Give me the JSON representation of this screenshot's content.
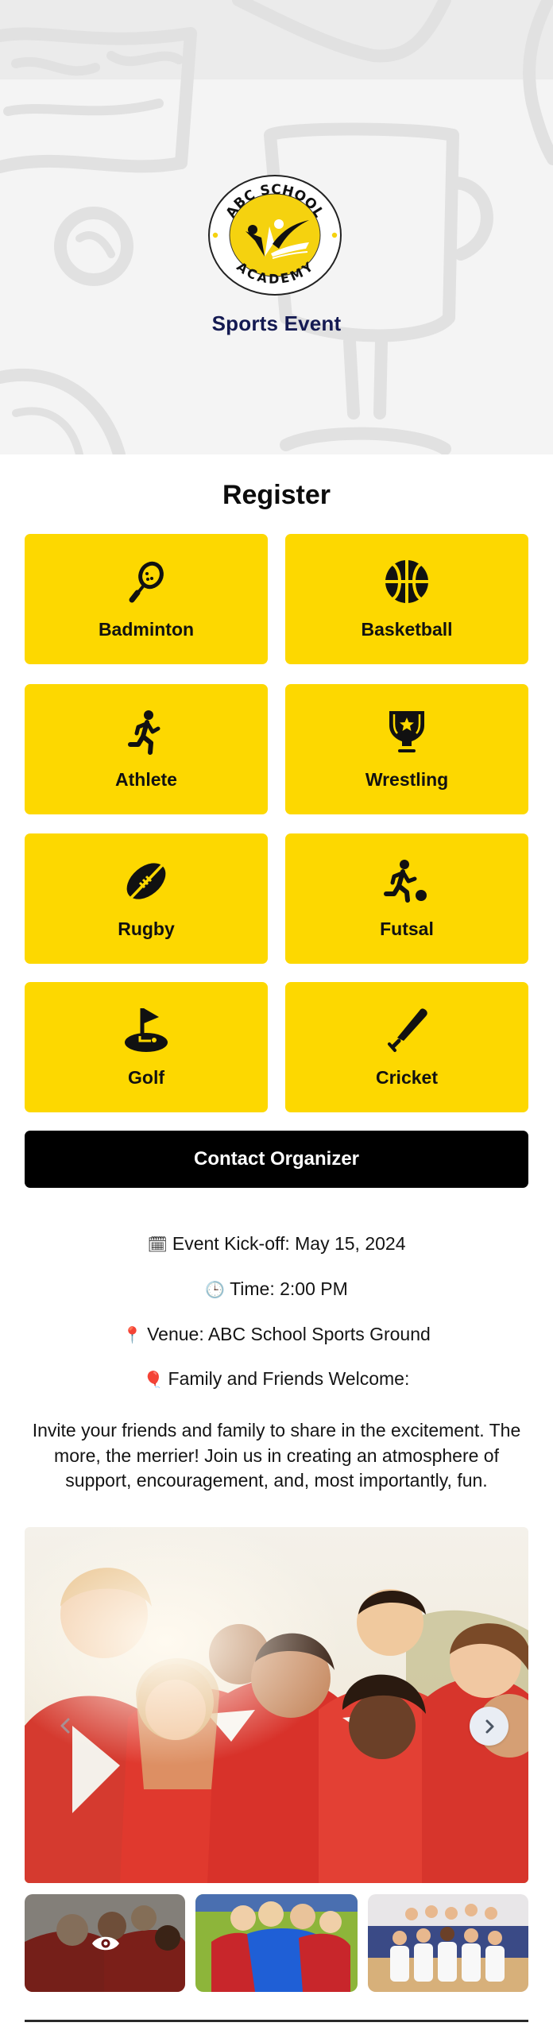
{
  "header": {
    "logo": {
      "top_text": "ABC SCHOOL",
      "bottom_text": "ACADEMY",
      "icon": "school-academy-logo"
    },
    "event_title": "Sports Event"
  },
  "register": {
    "title": "Register",
    "tiles": [
      {
        "label": "Badminton",
        "icon": "badminton-racket-icon"
      },
      {
        "label": "Basketball",
        "icon": "basketball-icon"
      },
      {
        "label": "Athlete",
        "icon": "running-person-icon"
      },
      {
        "label": "Wrestling",
        "icon": "trophy-star-icon"
      },
      {
        "label": "Rugby",
        "icon": "rugby-ball-icon"
      },
      {
        "label": "Futsal",
        "icon": "soccer-player-icon"
      },
      {
        "label": "Golf",
        "icon": "golf-flag-icon"
      },
      {
        "label": "Cricket",
        "icon": "cricket-bat-icon"
      }
    ],
    "contact_label": "Contact Organizer"
  },
  "details": {
    "kickoff": {
      "icon": "calendar-icon",
      "glyph": "🗓",
      "text": "Event Kick-off: May 15, 2024"
    },
    "time": {
      "icon": "clock-icon",
      "glyph": "🕒",
      "text": "Time: 2:00 PM"
    },
    "venue": {
      "icon": "pushpin-icon",
      "glyph": "📍",
      "text": "Venue: ABC School Sports Ground"
    },
    "family": {
      "icon": "balloon-icon",
      "glyph": "🎈",
      "text": "Family and Friends Welcome:"
    },
    "invite": "Invite your friends and family to share in the excitement. The more, the merrier! Join us in creating an atmosphere of support, encouragement, and, most importantly, fun."
  },
  "gallery": {
    "main_image": "kids-soccer-team-red-jerseys-photo",
    "thumbnails": [
      {
        "image": "kids-soccer-team-red-jerseys-photo",
        "selected": true,
        "overlay_icon": "eye-icon"
      },
      {
        "image": "boys-soccer-team-huddle-photo",
        "selected": false
      },
      {
        "image": "basketball-team-gym-photo",
        "selected": false
      }
    ],
    "prev_icon": "chevron-left-icon",
    "next_icon": "chevron-right-icon"
  },
  "colors": {
    "accent_yellow": "#fdd800",
    "title_navy": "#141a52",
    "button_black": "#000000"
  }
}
